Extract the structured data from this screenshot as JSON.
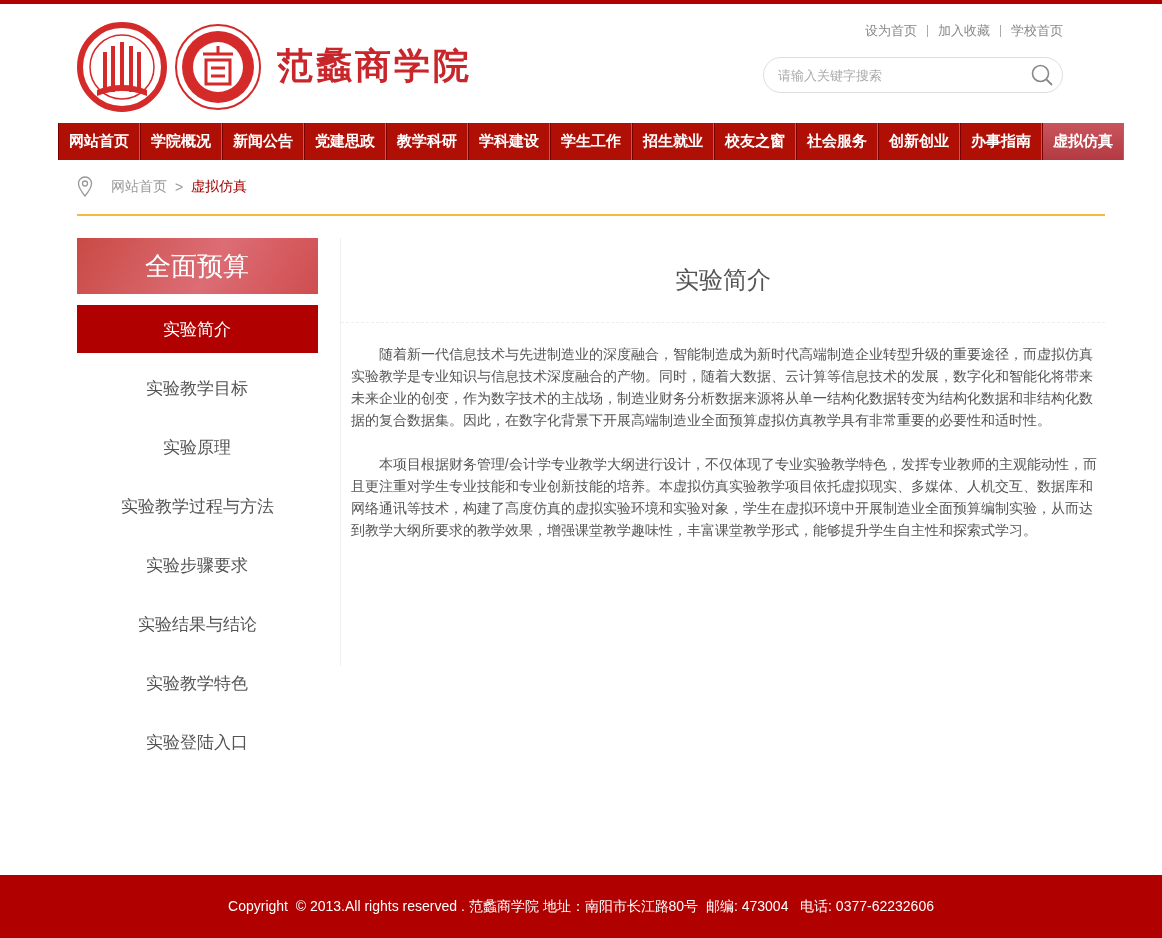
{
  "top_links": [
    "设为首页",
    "加入收藏",
    "学校首页"
  ],
  "site_name": "范蠡商学院",
  "search": {
    "placeholder": "请输入关键字搜索"
  },
  "nav": [
    {
      "label": "网站首页",
      "selected": false
    },
    {
      "label": "学院概况",
      "selected": false
    },
    {
      "label": "新闻公告",
      "selected": false
    },
    {
      "label": "党建思政",
      "selected": false
    },
    {
      "label": "教学科研",
      "selected": false
    },
    {
      "label": "学科建设",
      "selected": false
    },
    {
      "label": "学生工作",
      "selected": false
    },
    {
      "label": "招生就业",
      "selected": false
    },
    {
      "label": "校友之窗",
      "selected": false
    },
    {
      "label": "社会服务",
      "selected": false
    },
    {
      "label": "创新创业",
      "selected": false
    },
    {
      "label": "办事指南",
      "selected": false
    },
    {
      "label": "虚拟仿真",
      "selected": true
    }
  ],
  "breadcrumb": {
    "home": "网站首页",
    "separator": ">",
    "current": "虚拟仿真"
  },
  "sidebar": {
    "title": "全面预算",
    "items": [
      {
        "label": "实验简介",
        "selected": true
      },
      {
        "label": "实验教学目标",
        "selected": false
      },
      {
        "label": "实验原理",
        "selected": false
      },
      {
        "label": "实验教学过程与方法",
        "selected": false
      },
      {
        "label": "实验步骤要求",
        "selected": false
      },
      {
        "label": "实验结果与结论",
        "selected": false
      },
      {
        "label": "实验教学特色",
        "selected": false
      },
      {
        "label": "实验登陆入口",
        "selected": false
      }
    ]
  },
  "article": {
    "title": "实验简介",
    "paragraphs": [
      "随着新一代信息技术与先进制造业的深度融合，智能制造成为新时代高端制造企业转型升级的重要途径，而虚拟仿真实验教学是专业知识与信息技术深度融合的产物。同时，随着大数据、云计算等信息技术的发展，数字化和智能化将带来未来企业的创变，作为数字技术的主战场，制造业财务分析数据来源将从单一结构化数据转变为结构化数据和非结构化数据的复合数据集。因此，在数字化背景下开展高端制造业全面预算虚拟仿真教学具有非常重要的必要性和适时性。",
      "本项目根据财务管理/会计学专业教学大纲进行设计，不仅体现了专业实验教学特色，发挥专业教师的主观能动性，而且更注重对学生专业技能和专业创新技能的培养。本虚拟仿真实验教学项目依托虚拟现实、多媒体、人机交互、数据库和网络通讯等技术，构建了高度仿真的虚拟实验环境和实验对象，学生在虚拟环境中开展制造业全面预算编制实验，从而达到教学大纲所要求的教学效果，增强课堂教学趣味性，丰富课堂教学形式，能够提升学生自主性和探索式学习。"
    ]
  },
  "footer": "Copyright  © 2013.All rights reserved . 范蠡商学院 地址：南阳市长江路80号  邮编: 473004   电话: 0377-62232606"
}
